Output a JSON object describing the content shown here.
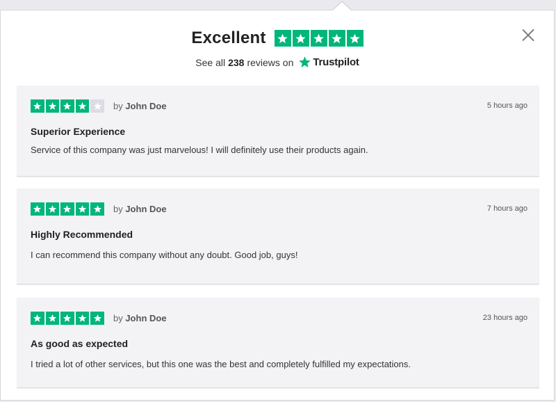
{
  "colors": {
    "star_green": "#00b67a",
    "star_empty": "#dcdce6",
    "logo_star": "#00b67a"
  },
  "header": {
    "rating_word": "Excellent",
    "rating_stars": 5,
    "summary_prefix": "See all",
    "review_count": "238",
    "summary_suffix": "reviews on",
    "brand_name": "Trustpilot",
    "close_icon": "close-icon"
  },
  "reviews": [
    {
      "stars": 4,
      "by_prefix": "by",
      "author": "John Doe",
      "time": "5 hours ago",
      "title": "Superior Experience",
      "body": "Service of this company was just marvelous! I will definitely use their products again."
    },
    {
      "stars": 5,
      "by_prefix": "by",
      "author": "John Doe",
      "time": "7 hours ago",
      "title": "Highly Recommended",
      "body": "I can recommend this company without any doubt. Good job, guys!"
    },
    {
      "stars": 5,
      "by_prefix": "by",
      "author": "John Doe",
      "time": "23 hours ago",
      "title": "As good as expected",
      "body": "I tried a lot of other services, but this one was the best and completely fulfilled my expectations."
    }
  ]
}
